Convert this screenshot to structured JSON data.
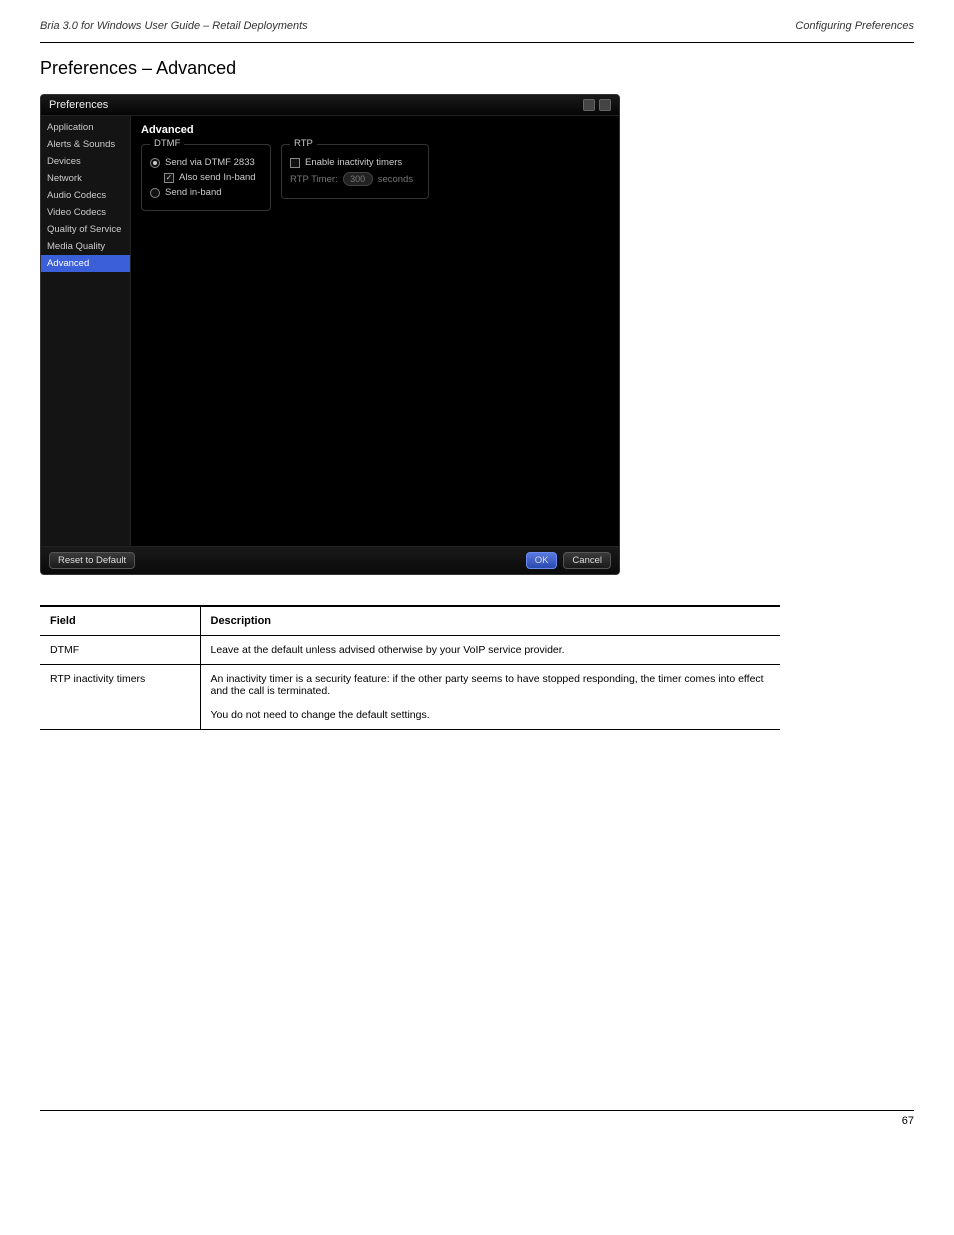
{
  "header": {
    "left": "Bria 3.0 for Windows User Guide – Retail Deployments",
    "right": "Configuring Preferences"
  },
  "section_title": "Preferences – Advanced",
  "window": {
    "title": "Preferences",
    "sidebar": {
      "items": [
        {
          "label": "Application"
        },
        {
          "label": "Alerts & Sounds"
        },
        {
          "label": "Devices"
        },
        {
          "label": "Network"
        },
        {
          "label": "Audio Codecs"
        },
        {
          "label": "Video Codecs"
        },
        {
          "label": "Quality of Service"
        },
        {
          "label": "Media Quality"
        },
        {
          "label": "Advanced"
        }
      ],
      "selected_index": 8
    },
    "content": {
      "title": "Advanced",
      "dtmf": {
        "legend": "DTMF",
        "opt1": "Send via DTMF 2833",
        "opt1_sub": "Also send In-band",
        "opt2": "Send in-band"
      },
      "rtp": {
        "legend": "RTP",
        "enable": "Enable inactivity timers",
        "timer_label": "RTP Timer:",
        "timer_value": "300",
        "timer_unit": "seconds"
      }
    },
    "footer": {
      "reset": "Reset to Default",
      "ok": "OK",
      "cancel": "Cancel"
    }
  },
  "table": {
    "headers": [
      "Field",
      "Description"
    ],
    "rows": [
      {
        "field": "DTMF",
        "desc": "Leave at the default unless advised otherwise by your VoIP service provider."
      },
      {
        "field": "RTP inactivity timers",
        "desc": "An inactivity timer is a security feature: if the other party seems to have stopped responding, the timer comes into effect and the call is terminated.\n\nYou do not need to change the default settings."
      }
    ]
  },
  "page_number": "67"
}
